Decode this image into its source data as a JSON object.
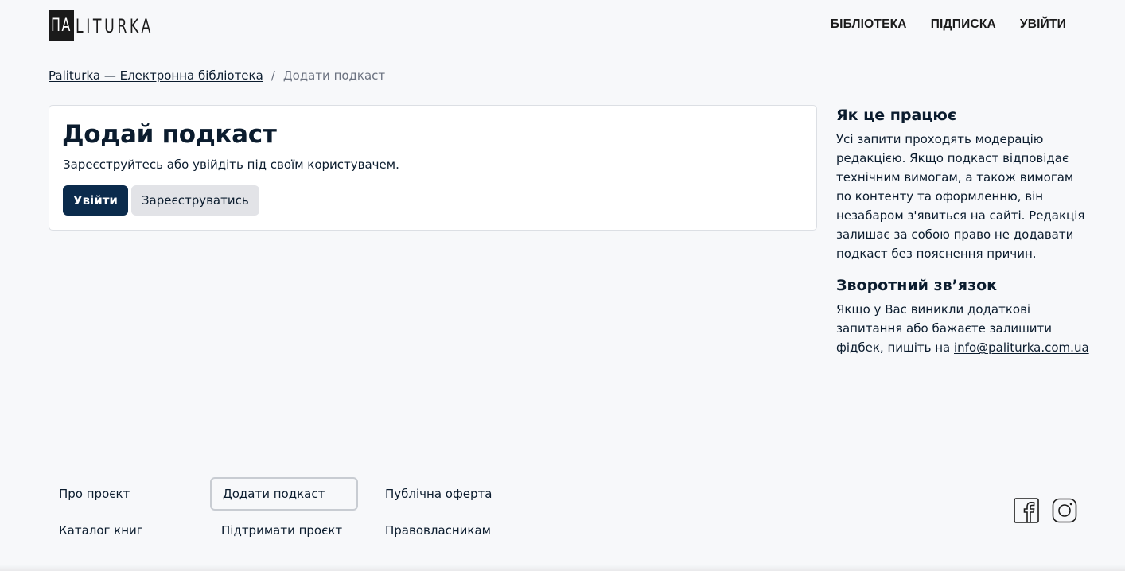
{
  "header": {
    "logo_mark": "ПА",
    "logo_text": "LITURKA",
    "nav": [
      {
        "label": "БІБЛІОТЕКА"
      },
      {
        "label": "ПІДПИСКА"
      },
      {
        "label": "УВІЙТИ"
      }
    ]
  },
  "breadcrumb": {
    "home": "Paliturka — Електронна бібліотека",
    "separator": "/",
    "current": "Додати подкаст"
  },
  "main": {
    "title": "Додай подкаст",
    "subtitle": "Зареєструйтесь або увійдіть під своїм користувачем.",
    "login_button": "Увійти",
    "register_button": "Зареєструватись"
  },
  "aside": {
    "how_title": "Як це працює",
    "how_text": "Усі запити проходять модерацію редакцією. Якщо подкаст відповідає технічним вимогам, а також вимогам по контенту та оформленню, він незабаром з'явиться на сайті. Редакція залишає за собою право не додавати подкаст без пояснення причин.",
    "feedback_title": "Зворотний зв’язок",
    "feedback_text": "Якщо у Вас виникли додаткові запитання або бажаєте залишити фідбек, пишіть на",
    "feedback_email": "info@paliturka.com.ua"
  },
  "footer": {
    "col1": [
      "Про проєкт",
      "Каталог книг"
    ],
    "col2": [
      "Додати подкаст",
      "Підтримати проєкт"
    ],
    "col3": [
      "Публічна оферта",
      "Правовласникам"
    ],
    "social": [
      "facebook-icon",
      "instagram-icon"
    ]
  },
  "colors": {
    "background": "#f7f8fa",
    "primary": "#0b2b4c",
    "text": "#0b1c2e",
    "muted": "#6b7280"
  }
}
